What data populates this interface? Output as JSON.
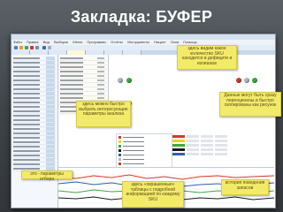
{
  "title": "Закладка: БУФЕР",
  "menu": [
    "Файл",
    "Правка",
    "Вид",
    "Выборки",
    "Меню",
    "Программы",
    "Отчёты",
    "Инструменты",
    "Нацист",
    "Окна",
    "Помощь"
  ],
  "callouts": {
    "top_right": "здесь видим какое количество SKU находится в дефиците и излишках",
    "right_mid": "Данные могут быть сразу переоценены и быстро скопированы как рисунок",
    "left_mid": "здесь можно быстро выбрать интересующие параметры анализа",
    "bottom_left": "это - параметры отбора",
    "bottom_mid": "здесь «окрашенные» таблицы с подробной информацией по каждому SKU",
    "bottom_right": "история поведения запасов"
  },
  "colors": {
    "callout_bg": "#f2eb6a",
    "slide_bg": "#3d4247",
    "red": "#d33a2c",
    "yellow": "#e8d12b",
    "green": "#3caa3c",
    "black": "#1a1a1a",
    "gray": "#b0b5ba",
    "blue": "#2f5fa8"
  },
  "icons": {
    "status_red": "circle-red-icon",
    "status_yellow": "circle-yellow-icon",
    "status_green": "circle-green-icon",
    "status_gray": "circle-gray-icon"
  }
}
